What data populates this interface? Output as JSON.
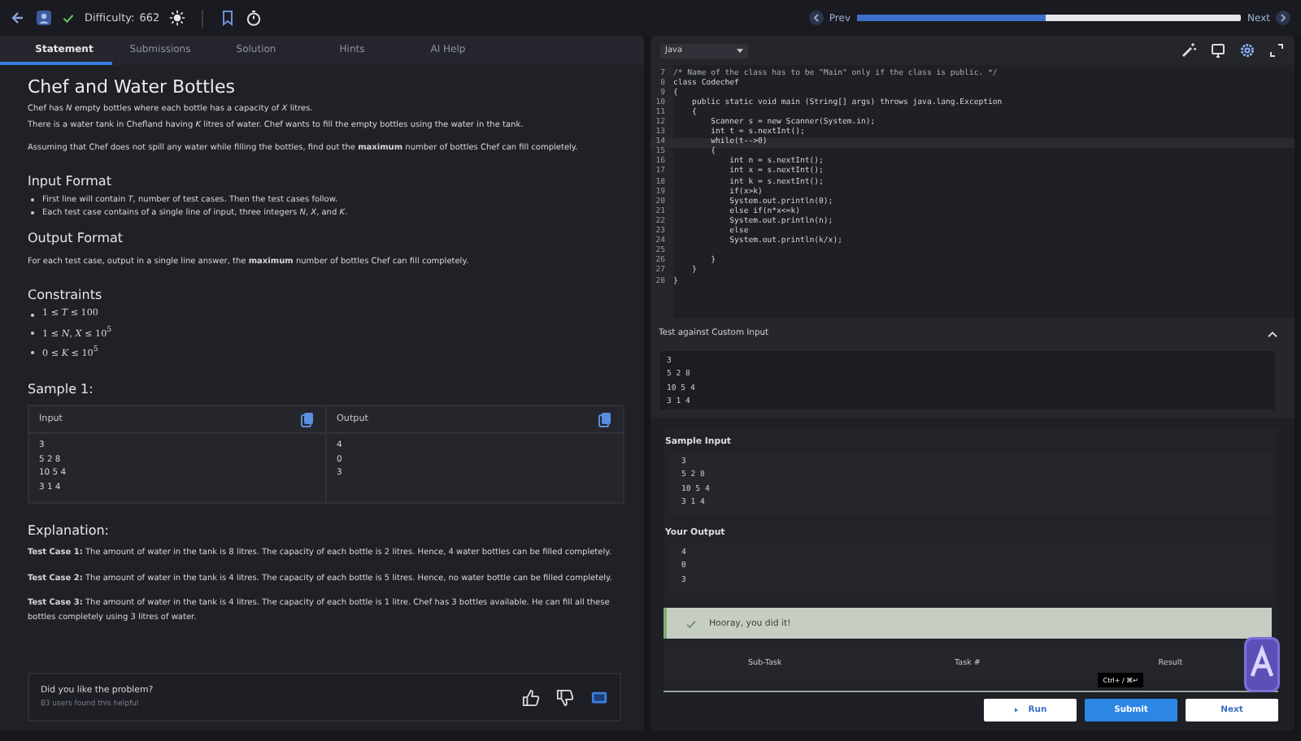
{
  "top_bar": {
    "solved": true,
    "difficulty_label": "Difficulty:",
    "difficulty": "662",
    "prev": "Prev",
    "next": "Next",
    "progress": {
      "level": 0.49
    }
  },
  "tabs": [
    {
      "label": "Statement",
      "selected": true
    },
    {
      "label": "Submissions",
      "selected": false
    },
    {
      "label": "Solution",
      "selected": false
    },
    {
      "label": "Hints",
      "selected": false
    },
    {
      "label": "AI Help",
      "selected": false
    }
  ],
  "statement": {
    "title": "Chef and Water Bottles",
    "intro": [
      "Chef has *N* empty bottles where each bottle has a capacity of *X* litres.",
      "There is a water tank in Chefland having *K* litres of water. Chef wants to fill the empty bottles using the water in the tank."
    ],
    "note": "Assuming that Chef does not spill any water while filling the bottles, find out the **maximum** number of bottles Chef can fill completely.",
    "input_format": {
      "heading": "Input Format",
      "items": [
        "First line will contain *T*, number of test cases. Then the test cases follow.",
        "Each test case contains of a single line of input, three integers *N*, *X*, and *K*."
      ]
    },
    "output_format": {
      "heading": "Output Format",
      "text": "For each test case, output in a single line answer, the **maximum** number of bottles Chef can fill completely."
    },
    "constraints": {
      "heading": "Constraints",
      "items": [
        "1 ≤ *T* ≤ 100",
        "1 ≤ *N*, *X* ≤ 10$^{5}$",
        "0 ≤ *K* ≤ 10$^{5}$"
      ]
    },
    "sample": {
      "heading": "Sample 1:",
      "input_label": "Input",
      "output_label": "Output",
      "input_lines": [
        "3",
        "5 2 8",
        "10 5 4",
        "3 1 4"
      ],
      "output_lines": [
        "4",
        "0",
        "3"
      ]
    },
    "explanation": {
      "heading": "Explanation:",
      "cases": [
        "**Test Case 1:** The amount of water in the tank is 8 litres. The capacity of each bottle is 2 litres. Hence, 4 water bottles can be filled completely.",
        "**Test Case 2:** The amount of water in the tank is 4 litres. The capacity of each bottle is 5 litres. Hence, no water bottle can be filled completely.",
        "**Test Case 3:** The amount of water in the tank is 4 litres. The capacity of each bottle is 1 litre. Chef has 3 bottles available. He can fill all these bottles completely using 3 litres of water."
      ]
    }
  },
  "feedback": {
    "question": "Did you like the problem?",
    "helpful": "83 users found this helpful"
  },
  "editor": {
    "language": "Java",
    "lines": [
      {
        "number": "7",
        "text": "/* Name of the class has to be \"Main\" only if the class is public. */",
        "kind": "comment",
        "selected": false
      },
      {
        "number": "8",
        "text": "class Codechef",
        "kind": "code",
        "selected": false
      },
      {
        "number": "9",
        "text": "{",
        "kind": "code",
        "selected": false
      },
      {
        "number": "10",
        "text": "    public static void main (String[] args) throws java.lang.Exception",
        "kind": "code",
        "selected": false
      },
      {
        "number": "11",
        "text": "    {",
        "kind": "code",
        "selected": false
      },
      {
        "number": "12",
        "text": "        Scanner s = new Scanner(System.in);",
        "kind": "code",
        "selected": false
      },
      {
        "number": "13",
        "text": "        int t = s.nextInt();",
        "kind": "code",
        "selected": false
      },
      {
        "number": "14",
        "text": "        while(t-->0)",
        "kind": "code",
        "selected": true
      },
      {
        "number": "15",
        "text": "        {",
        "kind": "code",
        "selected": false
      },
      {
        "number": "16",
        "text": "            int n = s.nextInt();",
        "kind": "code",
        "selected": false
      },
      {
        "number": "17",
        "text": "            int x = s.nextInt();",
        "kind": "code",
        "selected": false
      },
      {
        "number": "18",
        "text": "            int k = s.nextInt();",
        "kind": "code",
        "selected": false
      },
      {
        "number": "19",
        "text": "            if(x>k)",
        "kind": "code",
        "selected": false
      },
      {
        "number": "20",
        "text": "            System.out.println(0);",
        "kind": "code",
        "selected": false
      },
      {
        "number": "21",
        "text": "            else if(n*x<=k)",
        "kind": "code",
        "selected": false
      },
      {
        "number": "22",
        "text": "            System.out.println(n);",
        "kind": "code",
        "selected": false
      },
      {
        "number": "23",
        "text": "            else",
        "kind": "code",
        "selected": false
      },
      {
        "number": "24",
        "text": "            System.out.println(k/x);",
        "kind": "code",
        "selected": false
      },
      {
        "number": "25",
        "kind": "code",
        "selected": false
      },
      {
        "number": "26",
        "text": "        }",
        "kind": "code",
        "selected": false
      },
      {
        "number": "27",
        "text": "    }",
        "kind": "code",
        "selected": false
      },
      {
        "number": "28",
        "text": "}",
        "kind": "code",
        "selected": false
      }
    ]
  },
  "custom_input": {
    "title": "Test against Custom Input",
    "expanded": true,
    "lines": [
      "3",
      "5 2 8",
      "10 5 4",
      "3 1 4"
    ]
  },
  "result": {
    "sample_input": {
      "heading": "Sample Input",
      "lines": [
        "3",
        "5 2 8",
        "10 5 4",
        "3 1 4"
      ]
    },
    "your_output": {
      "heading": "Your Output",
      "lines": [
        "4",
        "0",
        "3"
      ]
    },
    "status": {
      "kind": "success",
      "message": "Hooray, you did it!"
    },
    "columns": [
      "Sub-Task",
      "Task #",
      "Result"
    ]
  },
  "tooltip": "Ctrl+ / ⌘↵",
  "buttons": [
    {
      "label": "Run",
      "kind": "run"
    },
    {
      "label": "Submit",
      "kind": "primary"
    },
    {
      "label": "Next",
      "kind": "secondary"
    }
  ]
}
